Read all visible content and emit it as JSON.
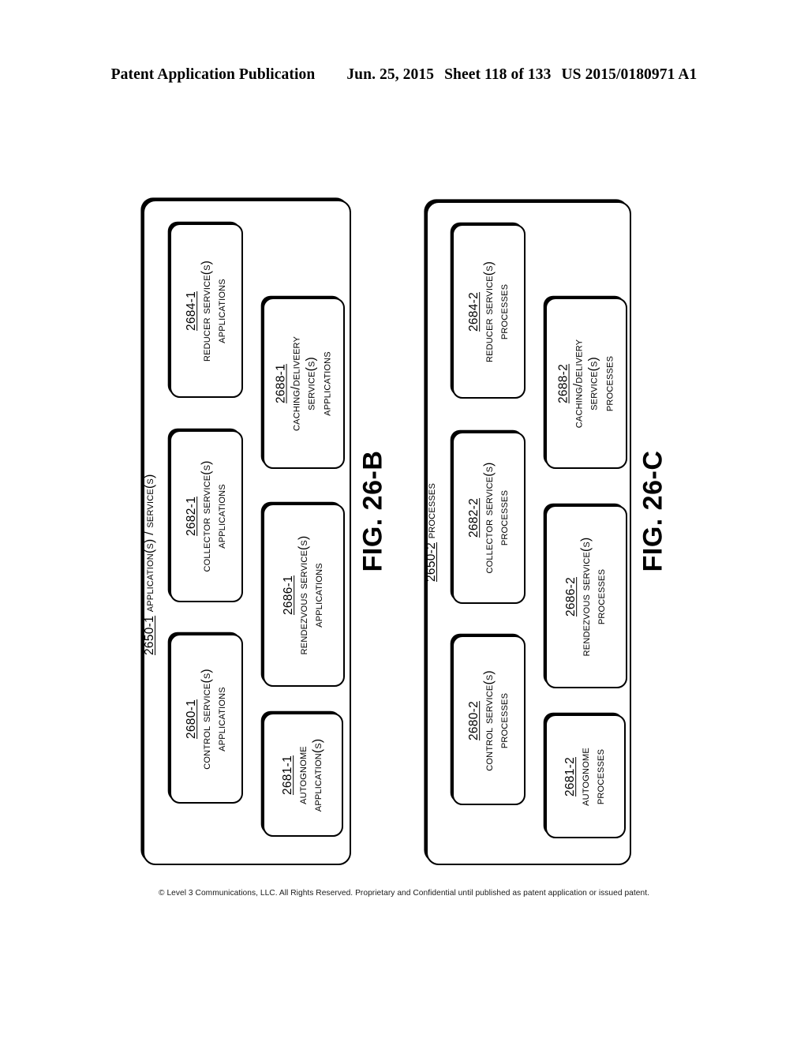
{
  "header": {
    "publication": "Patent Application Publication",
    "date": "Jun. 25, 2015",
    "sheet": "Sheet 118 of 133",
    "pub_number": "US 2015/0180971 A1"
  },
  "figures": [
    {
      "caption": "FIG. 26-B",
      "container_ref": "2650-1",
      "container_title": "APPLICATION(S) / SERVICE(S)",
      "nodes": [
        {
          "ref": "2684-1",
          "lines": [
            "REDUCER SERVICE(S)",
            "APPLICATIONS"
          ]
        },
        {
          "ref": "2682-1",
          "lines": [
            "COLLECTOR SERVICE(S)",
            "APPLICATIONS"
          ]
        },
        {
          "ref": "2680-1",
          "lines": [
            "CONTROL SERVICE(S)",
            "APPLICATIONS"
          ]
        },
        {
          "ref": "2688-1",
          "lines": [
            "CACHING/DELIVEERY",
            "SERVICE(S)",
            "APPLICATIONS"
          ]
        },
        {
          "ref": "2686-1",
          "lines": [
            "RENDEZVOUS SERVICE(S)",
            "APPLICATIONS"
          ]
        },
        {
          "ref": "2681-1",
          "lines": [
            "AUTOGNOME",
            "APPLICATION(S)"
          ]
        }
      ]
    },
    {
      "caption": "FIG. 26-C",
      "container_ref": "2650-2",
      "container_title": "PROCESSES",
      "nodes": [
        {
          "ref": "2684-2",
          "lines": [
            "REDUCER SERVICE(S)",
            "PROCESSES"
          ]
        },
        {
          "ref": "2682-2",
          "lines": [
            "COLLECTOR SERVICE(S)",
            "PROCESSES"
          ]
        },
        {
          "ref": "2680-2",
          "lines": [
            "CONTROL SERVICE(S)",
            "PROCESSES"
          ]
        },
        {
          "ref": "2688-2",
          "lines": [
            "CACHING/DELIVERY",
            "SERVICE(S)",
            "PROCESSES"
          ]
        },
        {
          "ref": "2686-2",
          "lines": [
            "RENDEZVOUS SERVICE(S)",
            "PROCESSES"
          ]
        },
        {
          "ref": "2681-2",
          "lines": [
            "AUTOGNOME",
            "PROCESSES"
          ]
        }
      ]
    }
  ],
  "footer": {
    "copyright": "© Level 3 Communications, LLC.  All Rights Reserved.  Proprietary and Confidential until published as patent application or issued patent."
  }
}
